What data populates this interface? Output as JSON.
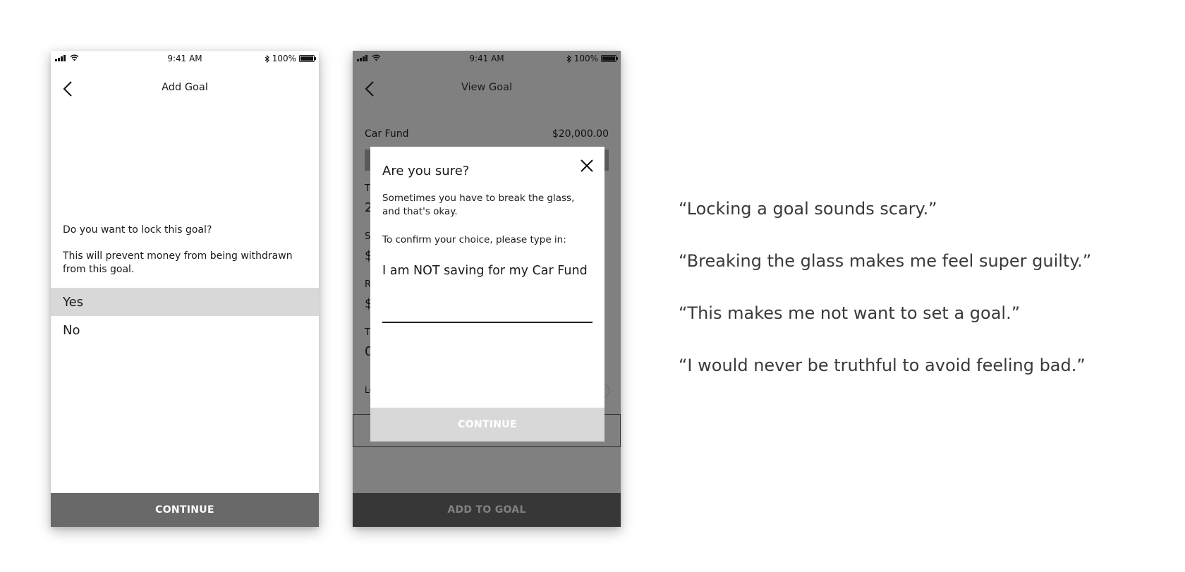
{
  "status_bar": {
    "time": "9:41 AM",
    "battery": "100%"
  },
  "screen_add_goal": {
    "title": "Add Goal",
    "question": "Do you want to lock this goal?",
    "description": "This will prevent money from being withdrawn from this goal.",
    "options": [
      {
        "label": "Yes",
        "selected": true
      },
      {
        "label": "No",
        "selected": false
      }
    ],
    "continue_label": "CONTINUE"
  },
  "screen_view_goal": {
    "title": "View Goal",
    "goal_name": "Car Fund",
    "goal_amount": "$20,000.00",
    "bg_fragments": [
      "T",
      "2",
      "S",
      "$",
      "R",
      "$",
      "T",
      "0",
      "Lo"
    ],
    "add_to_goal_label": "ADD TO GOAL",
    "modal": {
      "title": "Are you sure?",
      "text": "Sometimes you have to break the glass, and that's okay.",
      "confirm_prompt": "To confirm your choice, please type in:",
      "confirm_phrase": "I am NOT saving for my Car Fund",
      "input_value": "",
      "continue_label": "CONTINUE"
    }
  },
  "quotes": [
    "“Locking a goal sounds scary.”",
    "“Breaking the glass makes me feel super guilty.”",
    "“This makes me not want to set a goal.”",
    "“I would never be truthful to avoid feeling bad.”"
  ],
  "colors": {
    "selected_option": "#d8d8d8",
    "primary_button": "#696969",
    "overlay": "#808080",
    "dark_button": "#373737"
  }
}
